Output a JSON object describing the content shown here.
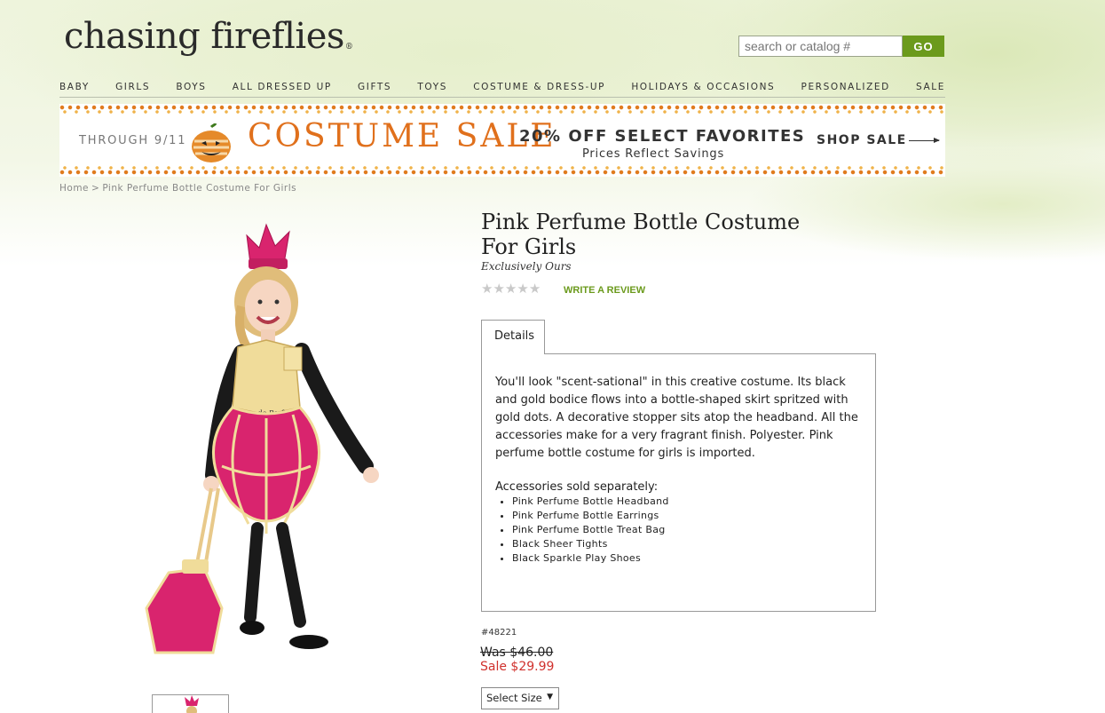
{
  "brand": {
    "logo_text": "chasing fireflies",
    "logo_mark": "®"
  },
  "search": {
    "placeholder": "search or catalog #",
    "button_label": "GO"
  },
  "nav": {
    "items": [
      "BABY",
      "GIRLS",
      "BOYS",
      "ALL DRESSED UP",
      "GIFTS",
      "TOYS",
      "COSTUME & DRESS-UP",
      "HOLIDAYS & OCCASIONS",
      "PERSONALIZED",
      "SALE"
    ]
  },
  "banner": {
    "through": "THROUGH 9/11",
    "title": "COSTUME SALE",
    "offer": "20% OFF SELECT FAVORITES",
    "prices_note": "Prices Reflect Savings",
    "shop_label": "SHOP SALE",
    "accent_color": "#e0701c"
  },
  "breadcrumb": {
    "home": "Home",
    "separator": ">",
    "current": "Pink Perfume Bottle Costume For Girls"
  },
  "product": {
    "title": "Pink Perfume Bottle Costume For Girls",
    "tagline": "Exclusively Ours",
    "rating_stars": 0,
    "rating_max": 5,
    "write_review": "WRITE A REVIEW",
    "tab_label": "Details",
    "description": "You'll look \"scent-sational\" in this creative costume. Its black and gold bodice flows into a bottle-shaped skirt spritzed with gold dots. A decorative stopper sits atop the headband. All the accessories make for a very fragrant finish. Polyester. Pink perfume bottle costume for girls is imported.",
    "accessories_heading": "Accessories sold separately:",
    "accessories": [
      "Pink Perfume Bottle Headband",
      "Pink Perfume Bottle Earrings",
      "Pink Perfume Bottle Treat Bag",
      "Black Sheer Tights",
      "Black Sparkle Play Shoes"
    ],
    "catalog_number": "#48221",
    "was_price": "Was $46.00",
    "sale_price": "Sale $29.99",
    "size_select": "Select Size",
    "bodice_text": "Eau de Parfum"
  },
  "colors": {
    "green": "#6b9a1c",
    "sale_red": "#d0312d",
    "pink": "#d9246e",
    "gold": "#f0dc9a"
  }
}
